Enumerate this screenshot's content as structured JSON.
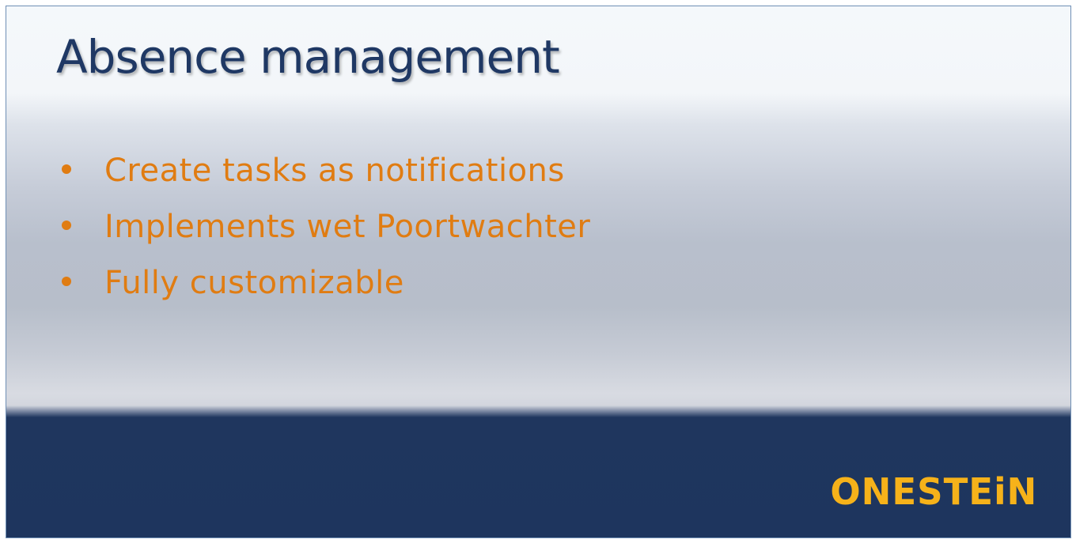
{
  "slide": {
    "title": "Absence management",
    "bullets": [
      "Create tasks as notifications",
      "Implements wet Poortwachter",
      "Fully customizable"
    ],
    "logo_text": "ONESTEiN"
  },
  "colors": {
    "title": "#1f3864",
    "bullets": "#e07c12",
    "footer_band": "#1e355e",
    "logo": "#f6b21a"
  }
}
